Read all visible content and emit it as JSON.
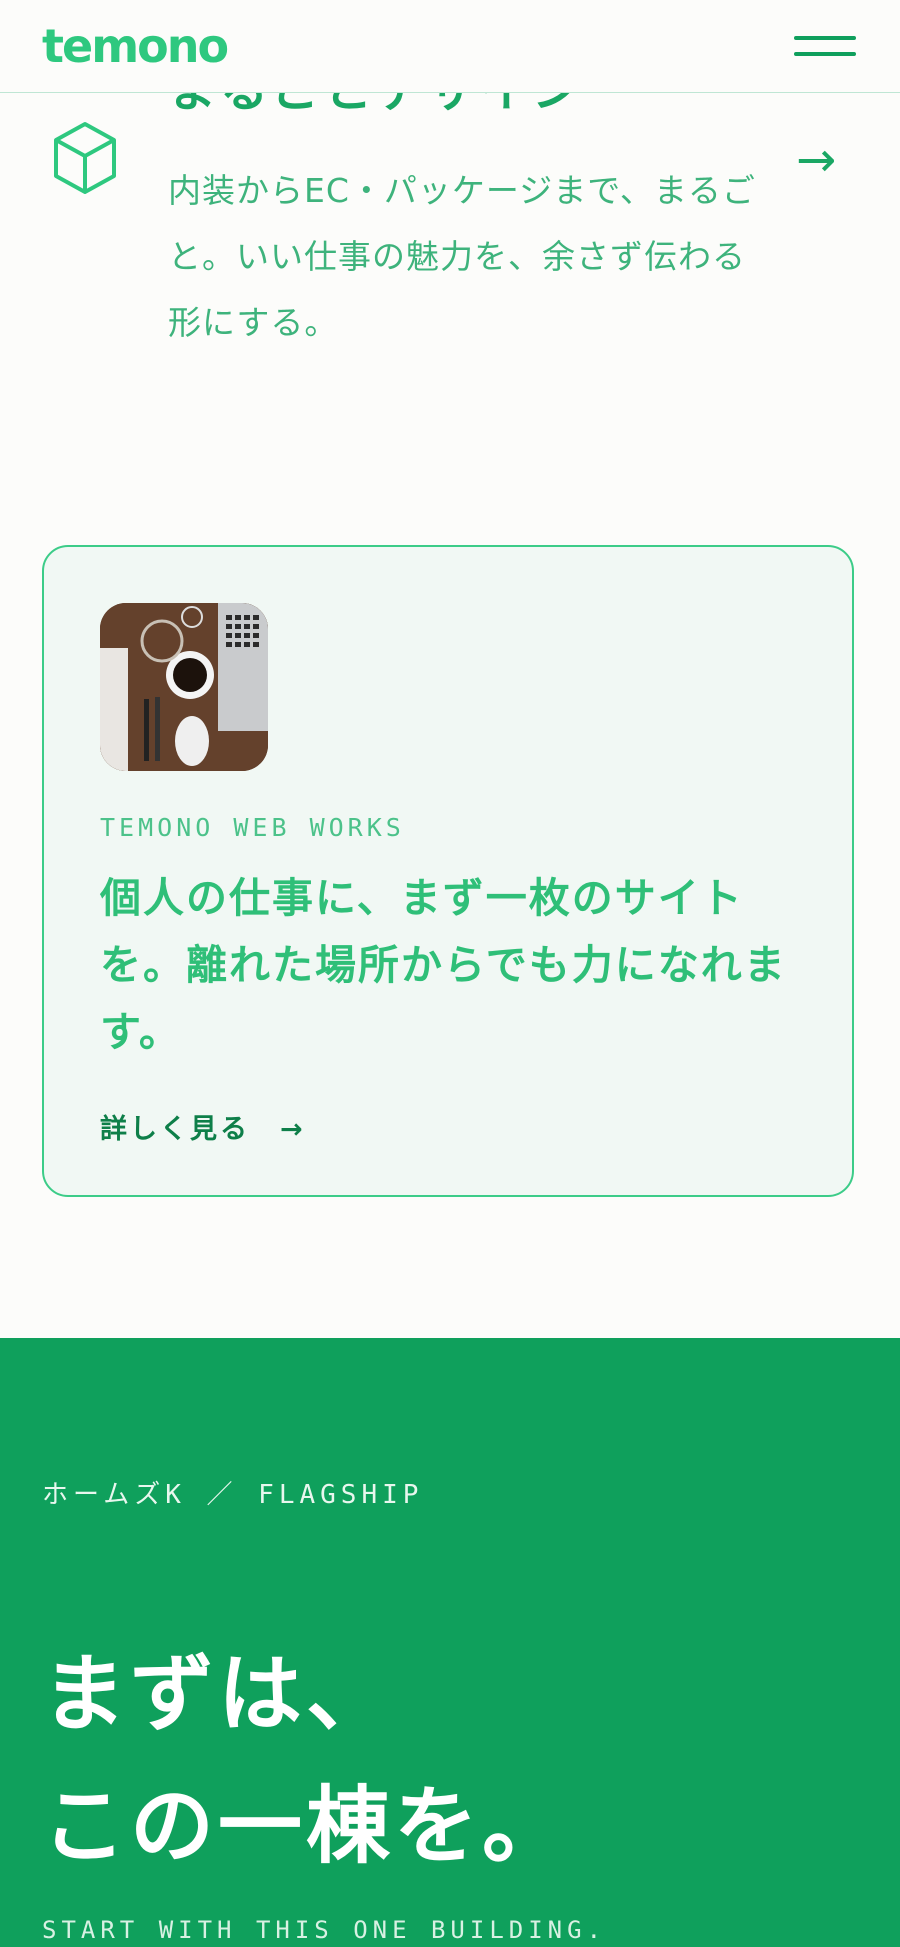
{
  "header": {
    "logo": "temono",
    "menu_icon": "hamburger-menu-icon"
  },
  "service": {
    "clipped_heading": "まるごとデザイン",
    "icon": "cube-icon",
    "description": "内装からEC・パッケージまで、まるごと。いい仕事の魅力を、余さず伝わる形にする。",
    "arrow": "→"
  },
  "card": {
    "image_alt": "desk-with-laptop-coffee-photo",
    "eyebrow": "TEMONO WEB WORKS",
    "title": "個人の仕事に、まず一枚のサイトを。離れた場所からでも力になれます。",
    "more_label": "詳しく見る　→"
  },
  "flagship": {
    "eyebrow": "ホームズK ／ FLAGSHIP",
    "heading_line1": "まずは、",
    "heading_line2": "この一棟を。",
    "subheading": "START WITH THIS ONE BUILDING."
  },
  "colors": {
    "brand_green": "#2ec87f",
    "dark_green": "#0fa05c",
    "card_bg": "#f1f8f4"
  }
}
